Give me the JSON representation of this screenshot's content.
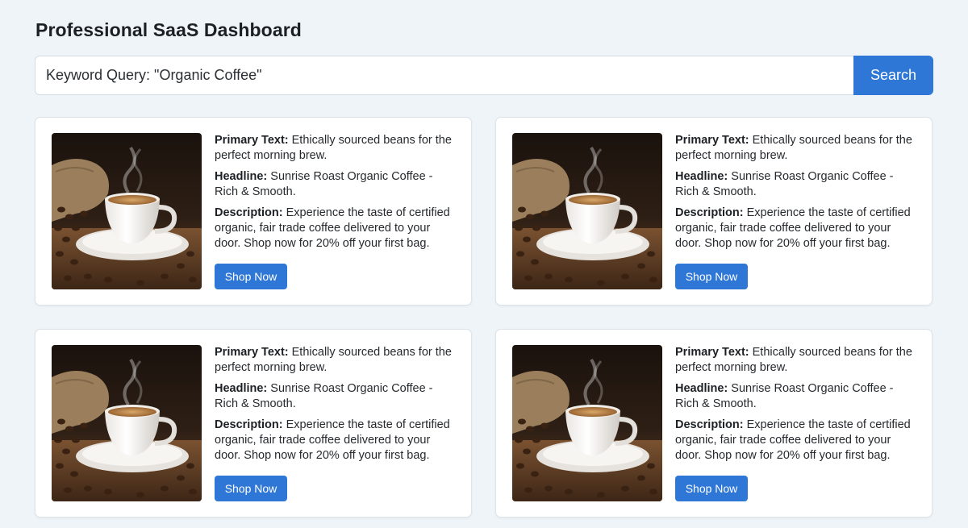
{
  "app": {
    "title": "Professional SaaS Dashboard"
  },
  "search": {
    "value": "Keyword Query: \"Organic Coffee\"",
    "button_label": "Search"
  },
  "ads": [
    {
      "primary_label": "Primary Text:",
      "primary_text": "Ethically sourced beans for the perfect morning brew.",
      "headline_label": "Headline:",
      "headline": "Sunrise Roast Organic Coffee - Rich & Smooth.",
      "description_label": "Description:",
      "description": "Experience the taste of certified organic, fair trade coffee delivered to your door. Shop now for 20% off your first bag.",
      "button_label": "Shop Now",
      "image_icon": "coffee-cup-photo-icon"
    },
    {
      "primary_label": "Primary Text:",
      "primary_text": "Ethically sourced beans for the perfect morning brew.",
      "headline_label": "Headline:",
      "headline": "Sunrise Roast Organic Coffee - Rich & Smooth.",
      "description_label": "Description:",
      "description": "Experience the taste of certified organic, fair trade coffee delivered to your door. Shop now for 20% off your first bag.",
      "button_label": "Shop Now",
      "image_icon": "coffee-cup-photo-icon"
    },
    {
      "primary_label": "Primary Text:",
      "primary_text": "Ethically sourced beans for the perfect morning brew.",
      "headline_label": "Headline:",
      "headline": "Sunrise Roast Organic Coffee - Rich & Smooth.",
      "description_label": "Description:",
      "description": "Experience the taste of certified organic, fair trade coffee delivered to your door. Shop now for 20% off your first bag.",
      "button_label": "Shop Now",
      "image_icon": "coffee-cup-photo-icon"
    },
    {
      "primary_label": "Primary Text:",
      "primary_text": "Ethically sourced beans for the perfect morning brew.",
      "headline_label": "Headline:",
      "headline": "Sunrise Roast Organic Coffee - Rich & Smooth.",
      "description_label": "Description:",
      "description": "Experience the taste of certified organic, fair trade coffee delivered to your door. Shop now for 20% off your first bag.",
      "button_label": "Shop Now",
      "image_icon": "coffee-cup-photo-icon"
    }
  ],
  "colors": {
    "accent": "#2f77d6",
    "background": "#eef4f8",
    "card": "#ffffff"
  }
}
